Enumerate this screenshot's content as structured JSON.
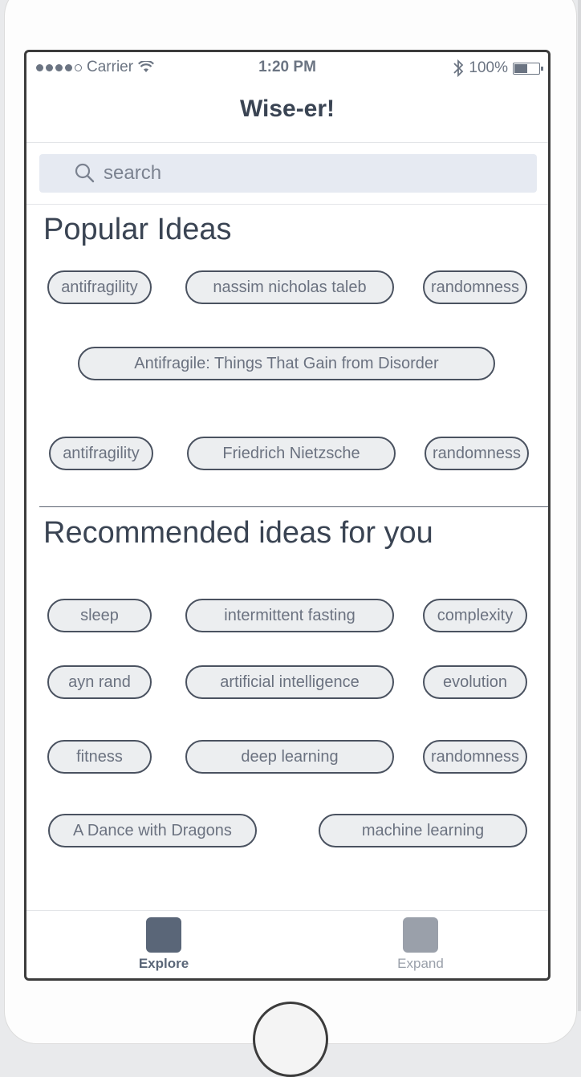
{
  "status_bar": {
    "carrier": "Carrier",
    "time": "1:20 PM",
    "battery_percent": "100%",
    "battery_level": 0.5,
    "signal_bars_filled": 4
  },
  "nav": {
    "title": "Wise-er!"
  },
  "search": {
    "placeholder": "search"
  },
  "popular": {
    "title": "Popular Ideas",
    "chips": [
      "antifragility",
      "nassim nicholas taleb",
      "randomness",
      "Antifragile: Things That Gain from Disorder",
      "antifragility",
      "Friedrich Nietzsche",
      "randomness"
    ]
  },
  "recommended": {
    "title": "Recommended ideas for you",
    "chips": [
      "sleep",
      "intermittent fasting",
      "complexity",
      "ayn rand",
      "artificial intelligence",
      "evolution",
      "fitness",
      "deep learning",
      "randomness",
      "A Dance with Dragons",
      "machine learning"
    ]
  },
  "tabs": [
    {
      "label": "Explore",
      "active": true,
      "color": "#5a6678"
    },
    {
      "label": "Expand",
      "active": false,
      "color": "#9aa0aa"
    }
  ],
  "colors": {
    "text_primary": "#3a4453",
    "chip_border": "#4a5260",
    "chip_fill": "#eceef0",
    "search_fill": "#e6eaf2"
  }
}
